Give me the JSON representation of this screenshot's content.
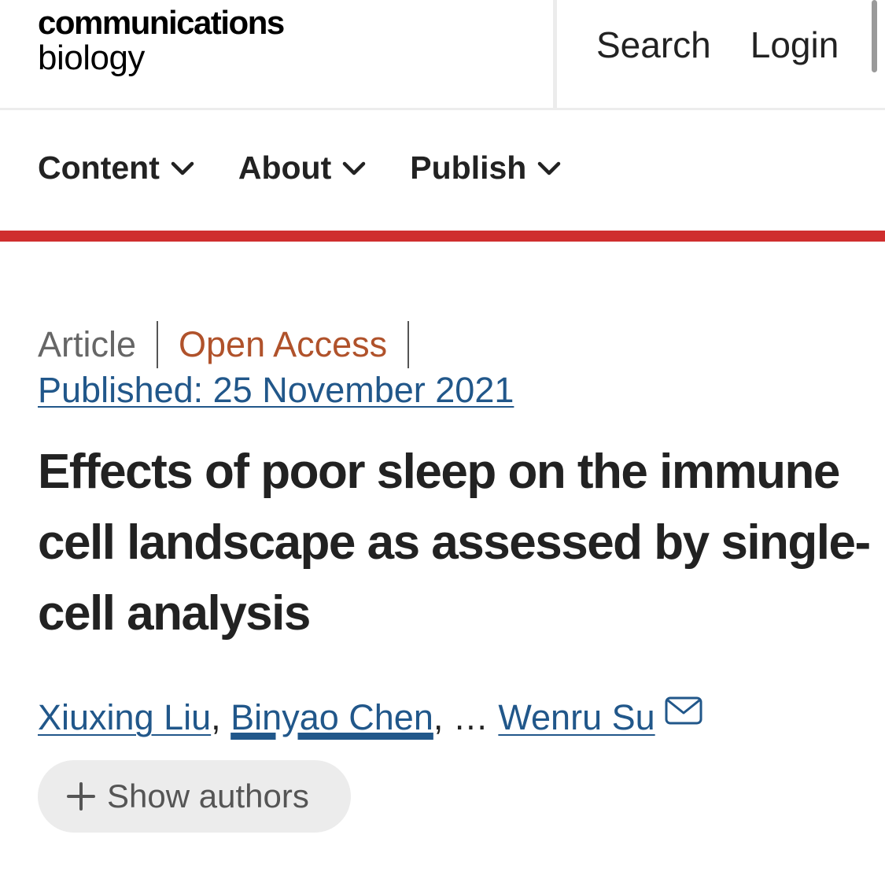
{
  "header": {
    "logo_line1": "communications",
    "logo_line2": "biology",
    "search_label": "Search",
    "login_label": "Login"
  },
  "nav": {
    "items": [
      {
        "label": "Content",
        "icon": "chevron-down-icon"
      },
      {
        "label": "About",
        "icon": "chevron-down-icon"
      },
      {
        "label": "Publish",
        "icon": "chevron-down-icon"
      }
    ]
  },
  "colors": {
    "brand_red": "#cf2e2e",
    "link_blue": "#21578a",
    "open_access_orange": "#b0522b"
  },
  "article": {
    "type": "Article",
    "access": "Open Access",
    "published": "Published: 25 November 2021",
    "title": "Effects of poor sleep on the immune cell landscape as assessed by single-cell analysis",
    "authors": {
      "first": "Xiuxing Liu",
      "second": "Binyao Chen",
      "comma": ", ",
      "ellipsis": ", … ",
      "last": "Wenru Su",
      "last_icon": "mail-icon"
    },
    "show_authors_label": "Show authors",
    "show_authors_icon": "plus-icon"
  }
}
